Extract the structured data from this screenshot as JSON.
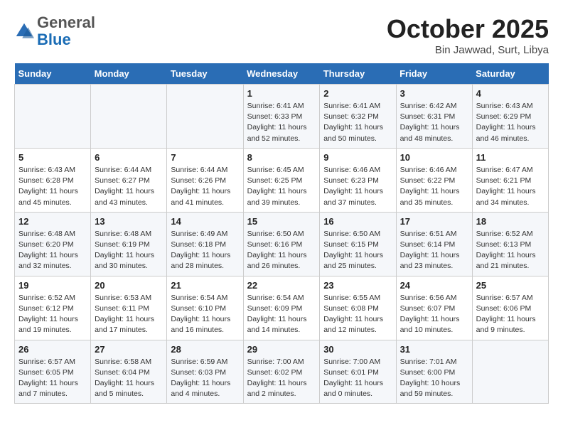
{
  "header": {
    "logo_general": "General",
    "logo_blue": "Blue",
    "month": "October 2025",
    "location": "Bin Jawwad, Surt, Libya"
  },
  "days_of_week": [
    "Sunday",
    "Monday",
    "Tuesday",
    "Wednesday",
    "Thursday",
    "Friday",
    "Saturday"
  ],
  "weeks": [
    [
      {
        "day": "",
        "info": ""
      },
      {
        "day": "",
        "info": ""
      },
      {
        "day": "",
        "info": ""
      },
      {
        "day": "1",
        "info": "Sunrise: 6:41 AM\nSunset: 6:33 PM\nDaylight: 11 hours\nand 52 minutes."
      },
      {
        "day": "2",
        "info": "Sunrise: 6:41 AM\nSunset: 6:32 PM\nDaylight: 11 hours\nand 50 minutes."
      },
      {
        "day": "3",
        "info": "Sunrise: 6:42 AM\nSunset: 6:31 PM\nDaylight: 11 hours\nand 48 minutes."
      },
      {
        "day": "4",
        "info": "Sunrise: 6:43 AM\nSunset: 6:29 PM\nDaylight: 11 hours\nand 46 minutes."
      }
    ],
    [
      {
        "day": "5",
        "info": "Sunrise: 6:43 AM\nSunset: 6:28 PM\nDaylight: 11 hours\nand 45 minutes."
      },
      {
        "day": "6",
        "info": "Sunrise: 6:44 AM\nSunset: 6:27 PM\nDaylight: 11 hours\nand 43 minutes."
      },
      {
        "day": "7",
        "info": "Sunrise: 6:44 AM\nSunset: 6:26 PM\nDaylight: 11 hours\nand 41 minutes."
      },
      {
        "day": "8",
        "info": "Sunrise: 6:45 AM\nSunset: 6:25 PM\nDaylight: 11 hours\nand 39 minutes."
      },
      {
        "day": "9",
        "info": "Sunrise: 6:46 AM\nSunset: 6:23 PM\nDaylight: 11 hours\nand 37 minutes."
      },
      {
        "day": "10",
        "info": "Sunrise: 6:46 AM\nSunset: 6:22 PM\nDaylight: 11 hours\nand 35 minutes."
      },
      {
        "day": "11",
        "info": "Sunrise: 6:47 AM\nSunset: 6:21 PM\nDaylight: 11 hours\nand 34 minutes."
      }
    ],
    [
      {
        "day": "12",
        "info": "Sunrise: 6:48 AM\nSunset: 6:20 PM\nDaylight: 11 hours\nand 32 minutes."
      },
      {
        "day": "13",
        "info": "Sunrise: 6:48 AM\nSunset: 6:19 PM\nDaylight: 11 hours\nand 30 minutes."
      },
      {
        "day": "14",
        "info": "Sunrise: 6:49 AM\nSunset: 6:18 PM\nDaylight: 11 hours\nand 28 minutes."
      },
      {
        "day": "15",
        "info": "Sunrise: 6:50 AM\nSunset: 6:16 PM\nDaylight: 11 hours\nand 26 minutes."
      },
      {
        "day": "16",
        "info": "Sunrise: 6:50 AM\nSunset: 6:15 PM\nDaylight: 11 hours\nand 25 minutes."
      },
      {
        "day": "17",
        "info": "Sunrise: 6:51 AM\nSunset: 6:14 PM\nDaylight: 11 hours\nand 23 minutes."
      },
      {
        "day": "18",
        "info": "Sunrise: 6:52 AM\nSunset: 6:13 PM\nDaylight: 11 hours\nand 21 minutes."
      }
    ],
    [
      {
        "day": "19",
        "info": "Sunrise: 6:52 AM\nSunset: 6:12 PM\nDaylight: 11 hours\nand 19 minutes."
      },
      {
        "day": "20",
        "info": "Sunrise: 6:53 AM\nSunset: 6:11 PM\nDaylight: 11 hours\nand 17 minutes."
      },
      {
        "day": "21",
        "info": "Sunrise: 6:54 AM\nSunset: 6:10 PM\nDaylight: 11 hours\nand 16 minutes."
      },
      {
        "day": "22",
        "info": "Sunrise: 6:54 AM\nSunset: 6:09 PM\nDaylight: 11 hours\nand 14 minutes."
      },
      {
        "day": "23",
        "info": "Sunrise: 6:55 AM\nSunset: 6:08 PM\nDaylight: 11 hours\nand 12 minutes."
      },
      {
        "day": "24",
        "info": "Sunrise: 6:56 AM\nSunset: 6:07 PM\nDaylight: 11 hours\nand 10 minutes."
      },
      {
        "day": "25",
        "info": "Sunrise: 6:57 AM\nSunset: 6:06 PM\nDaylight: 11 hours\nand 9 minutes."
      }
    ],
    [
      {
        "day": "26",
        "info": "Sunrise: 6:57 AM\nSunset: 6:05 PM\nDaylight: 11 hours\nand 7 minutes."
      },
      {
        "day": "27",
        "info": "Sunrise: 6:58 AM\nSunset: 6:04 PM\nDaylight: 11 hours\nand 5 minutes."
      },
      {
        "day": "28",
        "info": "Sunrise: 6:59 AM\nSunset: 6:03 PM\nDaylight: 11 hours\nand 4 minutes."
      },
      {
        "day": "29",
        "info": "Sunrise: 7:00 AM\nSunset: 6:02 PM\nDaylight: 11 hours\nand 2 minutes."
      },
      {
        "day": "30",
        "info": "Sunrise: 7:00 AM\nSunset: 6:01 PM\nDaylight: 11 hours\nand 0 minutes."
      },
      {
        "day": "31",
        "info": "Sunrise: 7:01 AM\nSunset: 6:00 PM\nDaylight: 10 hours\nand 59 minutes."
      },
      {
        "day": "",
        "info": ""
      }
    ]
  ]
}
